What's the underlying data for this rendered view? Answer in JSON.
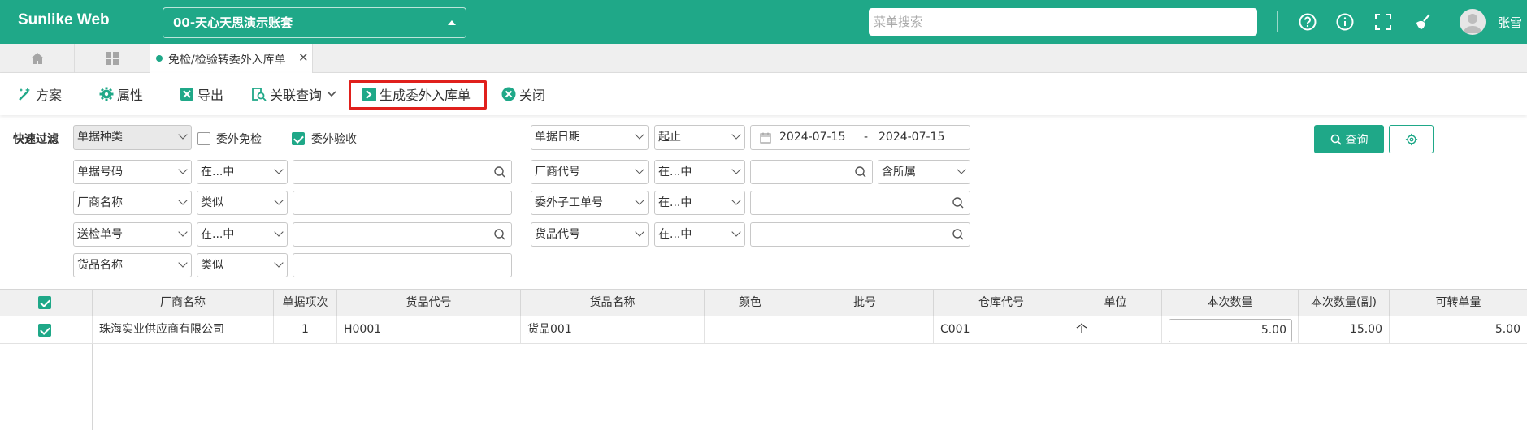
{
  "app": {
    "brand": "Sunlike Web",
    "account": "00-天心天思演示账套",
    "menu_search_placeholder": "菜单搜索",
    "user_name": "张雪"
  },
  "colors": {
    "primary": "#1fa888",
    "highlight": "#e0201c"
  },
  "tabs": [
    {
      "icon": "home-icon"
    },
    {
      "icon": "grid-icon"
    },
    {
      "label": "免检/检验转委外入库单",
      "active": true
    }
  ],
  "toolbar": {
    "scheme": "方案",
    "props": "属性",
    "export": "导出",
    "related_query": "关联查询",
    "generate": "生成委外入库单",
    "close": "关闭"
  },
  "filter": {
    "title": "快速过滤",
    "doc_type": "单据种类",
    "opt_exempt": "委外免检",
    "opt_accept": "委外验收",
    "doc_date": "单据日期",
    "date_mode": "起止",
    "date_from": "2024-07-15",
    "date_sep": "-",
    "date_to": "2024-07-15",
    "query_btn": "查询",
    "rows": [
      {
        "field": "单据号码",
        "op": "在...中"
      },
      {
        "field": "厂商名称",
        "op": "类似"
      },
      {
        "field": "送检单号",
        "op": "在...中"
      },
      {
        "field": "货品名称",
        "op": "类似"
      }
    ],
    "right_rows": [
      {
        "field": "厂商代号",
        "op": "在...中",
        "extra": "含所属"
      },
      {
        "field": "委外子工单号",
        "op": "在...中"
      },
      {
        "field": "货品代号",
        "op": "在...中"
      }
    ]
  },
  "grid": {
    "columns": [
      "厂商名称",
      "单据项次",
      "货品代号",
      "货品名称",
      "颜色",
      "批号",
      "仓库代号",
      "单位",
      "本次数量",
      "本次数量(副)",
      "可转单量"
    ],
    "rows": [
      {
        "vendor": "珠海实业供应商有限公司",
        "item_no": "1",
        "product_code": "H0001",
        "product_name": "货品001",
        "color": "",
        "batch": "",
        "warehouse": "C001",
        "unit": "个",
        "qty": "5.00",
        "qty_sub": "15.00",
        "convertible": "5.00"
      }
    ]
  }
}
